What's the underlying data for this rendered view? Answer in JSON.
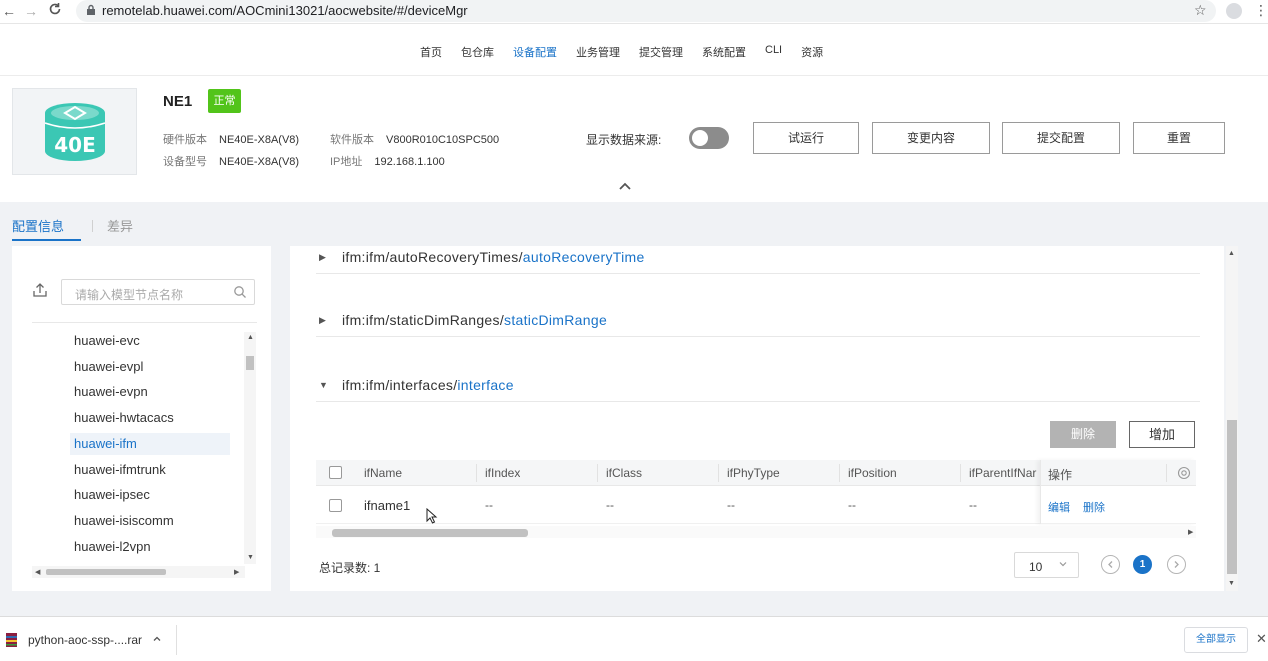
{
  "browser": {
    "url": "remotelab.huawei.com/AOCmini13021/aocwebsite/#/deviceMgr",
    "back": "←",
    "forward": "→",
    "reload": "C"
  },
  "nav": {
    "items": [
      "首页",
      "包仓库",
      "设备配置",
      "业务管理",
      "提交管理",
      "系统配置",
      "CLI",
      "资源"
    ],
    "active_index": 2
  },
  "device": {
    "name": "NE1",
    "status": "正常",
    "logo_text": "40E",
    "hw_version_label": "硬件版本",
    "hw_version": "NE40E-X8A(V8)",
    "model_label": "设备型号",
    "model": "NE40E-X8A(V8)",
    "sw_version_label": "软件版本",
    "sw_version": "V800R010C10SPC500",
    "ip_label": "IP地址",
    "ip": "192.168.1.100",
    "toggle_label": "显示数据来源:",
    "toggle_on": false,
    "buttons": [
      "试运行",
      "变更内容",
      "提交配置",
      "重置"
    ]
  },
  "tabs": {
    "active": "配置信息",
    "inactive": "差异"
  },
  "tree": {
    "search_placeholder": "请输入模型节点名称",
    "items": [
      "huawei-evc",
      "huawei-evpl",
      "huawei-evpn",
      "huawei-hwtacacs",
      "huawei-ifm",
      "huawei-ifmtrunk",
      "huawei-ipsec",
      "huawei-isiscomm",
      "huawei-l2vpn"
    ],
    "selected_index": 4
  },
  "sections": [
    {
      "prefix": "ifm:ifm/autoRecoveryTimes/",
      "leaf": "autoRecoveryTime",
      "expanded": false
    },
    {
      "prefix": "ifm:ifm/staticDimRanges/",
      "leaf": "staticDimRange",
      "expanded": false
    },
    {
      "prefix": "ifm:ifm/interfaces/",
      "leaf": "interface",
      "expanded": true
    }
  ],
  "table": {
    "delete_label": "删除",
    "add_label": "增加",
    "columns": [
      "ifName",
      "ifIndex",
      "ifClass",
      "ifPhyType",
      "ifPosition",
      "ifParentIfNar",
      "操作"
    ],
    "rows": [
      {
        "ifName": "ifname1",
        "ifIndex": "--",
        "ifClass": "--",
        "ifPhyType": "--",
        "ifPosition": "--",
        "ifParentIfName": "--",
        "edit": "编辑",
        "delete": "删除"
      }
    ]
  },
  "pagination": {
    "total_label": "总记录数: 1",
    "page_size": "10",
    "current_page": "1"
  },
  "downloads": {
    "file": "python-aoc-ssp-....rar",
    "show_all": "全部显示"
  },
  "colors": {
    "accent": "#1a73c8",
    "status_green": "#52c41a",
    "logo_teal": "#3bc7b4"
  }
}
